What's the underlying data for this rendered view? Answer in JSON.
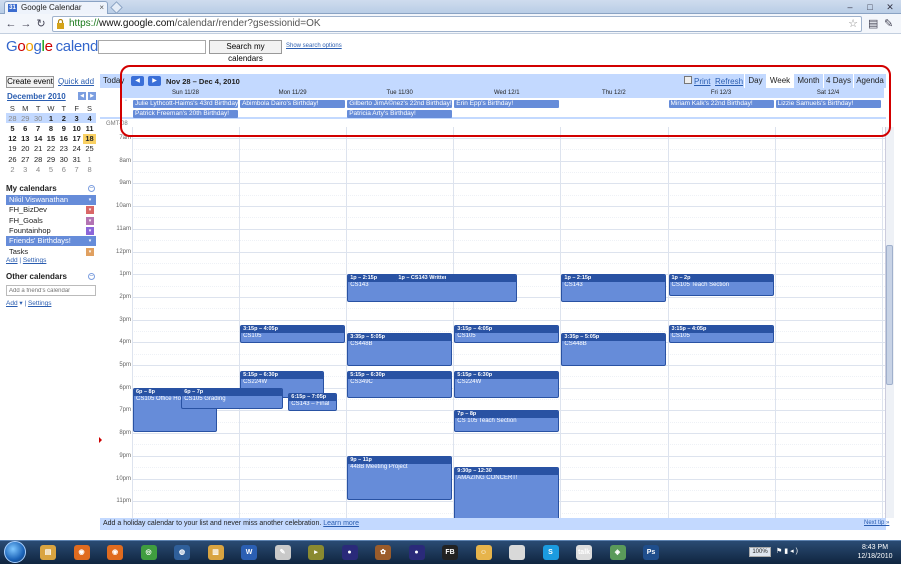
{
  "browser": {
    "tab_title": "Google Calendar",
    "favicon_text": "31",
    "url_scheme": "https://",
    "url_host": "www.google.com",
    "url_path": "/calendar/render?gsessionid=OK"
  },
  "header": {
    "logo_letters": [
      "G",
      "o",
      "o",
      "g",
      "l",
      "e"
    ],
    "logo_sub": "calendar",
    "search_placeholder": "",
    "search_button": "Search my calendars",
    "search_options": "Show search options"
  },
  "sidebar": {
    "create_event": "Create event",
    "quick_add": "Quick add",
    "mini_month": "December 2010",
    "mini_prev": "◀",
    "mini_next": "▶",
    "weekday_letters": [
      "S",
      "M",
      "T",
      "W",
      "T",
      "F",
      "S"
    ],
    "mini_weeks": [
      [
        "28",
        "29",
        "30",
        "1",
        "2",
        "3",
        "4"
      ],
      [
        "5",
        "6",
        "7",
        "8",
        "9",
        "10",
        "11"
      ],
      [
        "12",
        "13",
        "14",
        "15",
        "16",
        "17",
        "18"
      ],
      [
        "19",
        "20",
        "21",
        "22",
        "23",
        "24",
        "25"
      ],
      [
        "26",
        "27",
        "28",
        "29",
        "30",
        "31",
        "1"
      ],
      [
        "2",
        "3",
        "4",
        "5",
        "6",
        "7",
        "8"
      ]
    ],
    "my_calendars_title": "My calendars",
    "my_calendars": [
      {
        "label": "Nikil Viswanathan",
        "color": "#668cd9",
        "active": true
      },
      {
        "label": "FH_BizDev",
        "color": "#d96666",
        "active": false
      },
      {
        "label": "FH_Goals",
        "color": "#b373b3",
        "active": false
      },
      {
        "label": "Fountainhop",
        "color": "#8c66d9",
        "active": false
      },
      {
        "label": "Friends' Birthdays!",
        "color": "#668cd9",
        "active": true
      },
      {
        "label": "Tasks",
        "color": "#e0a060",
        "active": false
      }
    ],
    "add_label": "Add",
    "settings_label": "Settings",
    "other_calendars_title": "Other calendars",
    "friend_placeholder": "Add a friend's calendar"
  },
  "calendar": {
    "today_btn": "Today",
    "prev_btn": "◀",
    "next_btn": "▶",
    "date_range": "Nov 28 – Dec 4, 2010",
    "print_label": "Print",
    "refresh_label": "Refresh",
    "views": [
      "Day",
      "Week",
      "Month",
      "4 Days",
      "Agenda"
    ],
    "active_view": "Week",
    "days": [
      "Sun 11/28",
      "Mon 11/29",
      "Tue 11/30",
      "Wed 12/1",
      "Thu 12/2",
      "Fri 12/3",
      "Sat 12/4"
    ],
    "timezone": "GMT-08",
    "hours": [
      "7am",
      "8am",
      "9am",
      "10am",
      "11am",
      "12pm",
      "1pm",
      "2pm",
      "3pm",
      "4pm",
      "5pm",
      "6pm",
      "7pm",
      "8pm",
      "9pm",
      "10pm",
      "11pm"
    ],
    "allday_events": [
      {
        "text": "Julie Lythcott-Haims's 43rd Birthday!",
        "day": 0,
        "row": 0
      },
      {
        "text": "Patrick Freeman's 20th Birthday!",
        "day": 0,
        "row": 1
      },
      {
        "text": "Abimbola Dairo's Birthday!",
        "day": 1,
        "row": 0
      },
      {
        "text": "Gilberto JimÃ©nez's 22nd Birthday!",
        "day": 2,
        "row": 0
      },
      {
        "text": "Patricia Arty's Birthday!",
        "day": 2,
        "row": 1
      },
      {
        "text": "Erin Epp's Birthday!",
        "day": 3,
        "row": 0
      },
      {
        "text": "Miriam Kalk's 22nd Birthday!",
        "day": 5,
        "row": 0
      },
      {
        "text": "Lizzie Samuels's Birthday!",
        "day": 6,
        "row": 0
      }
    ],
    "events": [
      {
        "time": "1p – 2:15p",
        "title": "CS143",
        "day": 2,
        "start": 13,
        "end": 14.25,
        "col": 0,
        "cols": 1.6
      },
      {
        "time": "1p – CS143 Written",
        "title": "",
        "day": 2,
        "start": 13,
        "end": 13.4,
        "col": 0.45,
        "cols": 0.5
      },
      {
        "time": "1p – 2:15p",
        "title": "CS143",
        "day": 4,
        "start": 13,
        "end": 14.25,
        "col": 0,
        "cols": 1
      },
      {
        "time": "1p – 2p",
        "title": "CS105 Teach Section",
        "day": 5,
        "start": 13,
        "end": 14,
        "col": 0,
        "cols": 1
      },
      {
        "time": "3:15p – 4:05p",
        "title": "CS105",
        "day": 1,
        "start": 15.25,
        "end": 16.08,
        "col": 0,
        "cols": 1
      },
      {
        "time": "3:35p – 5:05p",
        "title": "CS448B",
        "day": 2,
        "start": 15.58,
        "end": 17.08,
        "col": 0,
        "cols": 1
      },
      {
        "time": "3:15p – 4:05p",
        "title": "CS105",
        "day": 3,
        "start": 15.25,
        "end": 16.08,
        "col": 0,
        "cols": 1
      },
      {
        "time": "3:35p – 5:05p",
        "title": "CS448B",
        "day": 4,
        "start": 15.58,
        "end": 17.08,
        "col": 0,
        "cols": 1
      },
      {
        "time": "3:15p – 4:05p",
        "title": "CS105",
        "day": 5,
        "start": 15.25,
        "end": 16.08,
        "col": 0,
        "cols": 1
      },
      {
        "time": "5:15p – 6:30p",
        "title": "CS224W",
        "day": 1,
        "start": 17.25,
        "end": 18.5,
        "col": 0,
        "cols": 0.8
      },
      {
        "time": "6:15p – 7:05p",
        "title": "CS143 – Final",
        "day": 1,
        "start": 18.25,
        "end": 19.08,
        "col": 0.45,
        "cols": 0.47
      },
      {
        "time": "5:15p – 6:30p",
        "title": "CS349C",
        "day": 2,
        "start": 17.25,
        "end": 18.5,
        "col": 0,
        "cols": 1
      },
      {
        "time": "5:15p – 6:30p",
        "title": "CS224W",
        "day": 3,
        "start": 17.25,
        "end": 18.5,
        "col": 0,
        "cols": 1
      },
      {
        "time": "6p – 8p",
        "title": "CS105 Office Hours",
        "day": 0,
        "start": 18,
        "end": 20,
        "col": 0,
        "cols": 0.8
      },
      {
        "time": "6p – 7p",
        "title": "CS105 Grading",
        "day": 0,
        "start": 18,
        "end": 19,
        "col": 0.45,
        "cols": 0.97
      },
      {
        "time": "7p – 8p",
        "title": "CS 105 Teach Section",
        "day": 3,
        "start": 19,
        "end": 20,
        "col": 0,
        "cols": 1
      },
      {
        "time": "9p – 11p",
        "title": "448B Meeting Project",
        "day": 2,
        "start": 21,
        "end": 23,
        "col": 0,
        "cols": 1
      },
      {
        "time": "9:30p – 12:30",
        "title": "AMAZING CONCERT!",
        "day": 3,
        "start": 21.5,
        "end": 24,
        "col": 0,
        "cols": 1
      }
    ],
    "footer_prefix": "Add a holiday calendar to your list and never miss another celebration.",
    "footer_link": "Learn more",
    "next_link": "Next tip »"
  },
  "taskbar": {
    "apps": [
      {
        "name": "explorer",
        "color": "#d9a441",
        "glyph": "▤"
      },
      {
        "name": "firefox",
        "color": "#e06b1f",
        "glyph": "◉"
      },
      {
        "name": "firefox-2",
        "color": "#e06b1f",
        "glyph": "◉"
      },
      {
        "name": "chrome",
        "color": "#3f9d3f",
        "glyph": "◎"
      },
      {
        "name": "network",
        "color": "#2f5f9a",
        "glyph": "◍"
      },
      {
        "name": "folder",
        "color": "#d9a441",
        "glyph": "▥"
      },
      {
        "name": "word",
        "color": "#2b5fb3",
        "glyph": "W"
      },
      {
        "name": "notepad",
        "color": "#c9c9c9",
        "glyph": "✎"
      },
      {
        "name": "terminal",
        "color": "#8a8a30",
        "glyph": "▸"
      },
      {
        "name": "eclipse",
        "color": "#2a2a7a",
        "glyph": "●"
      },
      {
        "name": "media",
        "color": "#9b5c2b",
        "glyph": "✿"
      },
      {
        "name": "eclipse-2",
        "color": "#2a2a7a",
        "glyph": "●"
      },
      {
        "name": "fb",
        "color": "#222222",
        "glyph": "FB"
      },
      {
        "name": "messenger",
        "color": "#e7b44b",
        "glyph": "☺"
      },
      {
        "name": "blank",
        "color": "#d9d9d9",
        "glyph": ""
      },
      {
        "name": "skype",
        "color": "#1b9be0",
        "glyph": "S"
      },
      {
        "name": "gtalk",
        "color": "#dddddd",
        "glyph": "talk"
      },
      {
        "name": "app",
        "color": "#5a9a5a",
        "glyph": "◈"
      },
      {
        "name": "photoshop",
        "color": "#1f4e8c",
        "glyph": "Ps"
      }
    ],
    "zoom": "100%",
    "time": "8:43 PM",
    "date": "12/18/2010"
  }
}
